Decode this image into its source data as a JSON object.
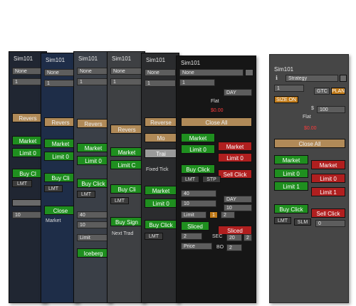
{
  "colors": {
    "buy": "#1f8f1f",
    "sell": "#b01f1f",
    "reverse": "#b08a58",
    "panel_dark": "#1b1b1b"
  },
  "panels": [
    {
      "title": "Sim101",
      "account": "None",
      "qty": "1",
      "reverse": "Revers",
      "market": "Market",
      "limit": "Limit 0",
      "buy_click": "Buy Cl",
      "lmt": "LMT",
      "qty_field": "10"
    },
    {
      "title": "Sim101",
      "account": "None",
      "qty": "1",
      "reverse": "Revers",
      "market": "Market",
      "limit": "Limit 0",
      "buy_click": "Buy Cli",
      "lmt": "LMT",
      "close": "Close",
      "order_type": "Market"
    },
    {
      "title": "Sim101",
      "account": "None",
      "qty": "1",
      "reverse": "Revers",
      "market": "Market",
      "limit": "Limit 0",
      "buy_click": "Buy Click",
      "lmt": "LMT",
      "v1": "40",
      "v2": "10",
      "limit_sel": "Limit",
      "iceberg": "Iceberg"
    },
    {
      "title": "Sim101",
      "account": "None",
      "qty": "1",
      "reverse": "Revers",
      "market": "Market",
      "limit": "Limit C",
      "buy_click": "Buy Cli",
      "lmt": "LMT",
      "buy_signal": "Buy Sign",
      "next_trade": "Next Trad"
    },
    {
      "title": "Sim101",
      "account": "None",
      "qty": "1",
      "reverse": "Reverse",
      "mo": "Mo",
      "trail": "Trai",
      "fixed_tick": "Fixed Tick",
      "market": "Market",
      "limit": "Limit 0",
      "buy_click": "Buy Click",
      "lmt": "LMT"
    },
    {
      "title": "Sim101",
      "account": "None",
      "qty": "1",
      "tif": "DAY",
      "flat": "Flat",
      "pnl": "$0.00",
      "close_all": "Close All",
      "market_buy": "Market",
      "market_sell": "Market",
      "limit_buy": "Limit 0",
      "limit_sell": "Limit 0",
      "buy_click": "Buy Click",
      "sell_click": "Sell Click",
      "lmt": "LMT",
      "stp": "STP",
      "f1": "40",
      "f1b": "DAY",
      "f2": "10",
      "f2b": "10",
      "limit_sel": "Limit",
      "n1": "1",
      "n2": "2",
      "sliced_buy": "Sliced",
      "sliced_sell": "Sliced",
      "s1": "2",
      "sec": "SEC",
      "s2": "20",
      "s3": "2",
      "price": "Price",
      "bo": "BO",
      "bo_val": "2"
    }
  ],
  "right_panel": {
    "title": "Sim101",
    "strategy": "Strategy",
    "qty": "1",
    "tif": "GTC",
    "plan": "PLAN",
    "size_on": "SIZE ON",
    "dollar": "$",
    "size_val": "100",
    "flat": "Flat",
    "pnl": "$0.00",
    "close_all": "Close All",
    "market_buy": "Market",
    "market_sell": "Market",
    "limit0_buy": "Limit 0",
    "limit0_sell": "Limit 0",
    "limit1_buy": "Limit 1",
    "limit1_sell": "Limit 1",
    "buy_click": "Buy Click",
    "sell_click": "Sell Click",
    "lmt": "LMT",
    "slm": "SLM",
    "zero": "0"
  }
}
